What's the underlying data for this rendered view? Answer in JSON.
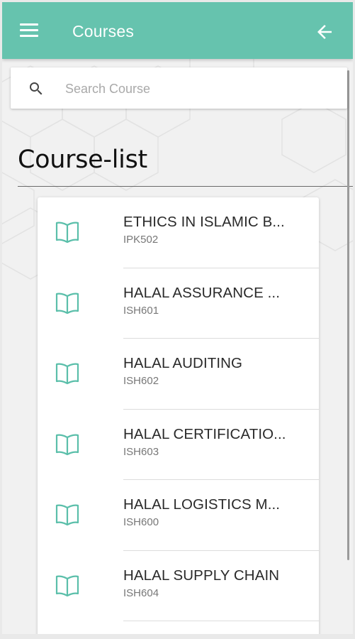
{
  "app_bar": {
    "title": "Courses",
    "menu_icon": "menu-icon",
    "back_icon": "arrow-back-icon",
    "background_color": "#66c3ae"
  },
  "search": {
    "placeholder": "Search Course",
    "value": "",
    "icon": "search-icon"
  },
  "section": {
    "title": "Course-list"
  },
  "courses": [
    {
      "name": "ETHICS IN ISLAMIC B...",
      "code": "IPK502",
      "icon": "book-icon"
    },
    {
      "name": "HALAL ASSURANCE ...",
      "code": "ISH601",
      "icon": "book-icon"
    },
    {
      "name": "HALAL AUDITING",
      "code": "ISH602",
      "icon": "book-icon"
    },
    {
      "name": "HALAL CERTIFICATIO...",
      "code": "ISH603",
      "icon": "book-icon"
    },
    {
      "name": "HALAL LOGISTICS M...",
      "code": "ISH600",
      "icon": "book-icon"
    },
    {
      "name": "HALAL SUPPLY CHAIN",
      "code": "ISH604",
      "icon": "book-icon"
    }
  ],
  "colors": {
    "accent": "#5bbfaa",
    "page_background": "#f1f1f1"
  }
}
